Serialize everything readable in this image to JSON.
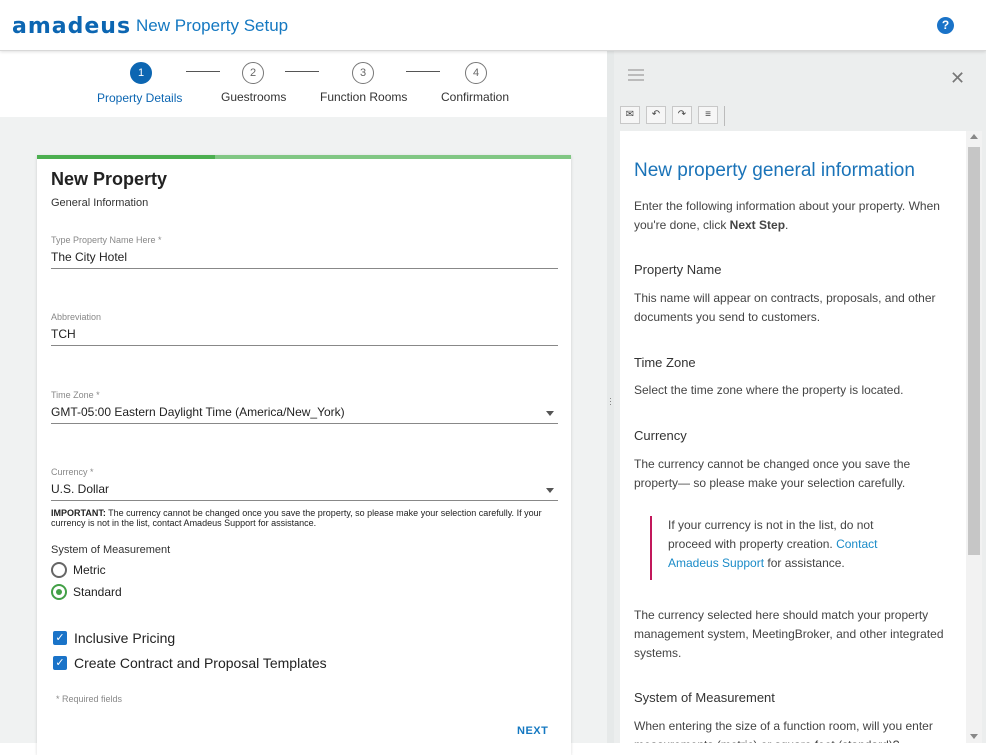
{
  "header": {
    "logo": "amadeus",
    "app_title": "New Property Setup",
    "help_icon": "?"
  },
  "stepper": {
    "steps": [
      {
        "number": "1",
        "label": "Property Details",
        "active": true
      },
      {
        "number": "2",
        "label": "Guestrooms",
        "active": false
      },
      {
        "number": "3",
        "label": "Function Rooms",
        "active": false
      },
      {
        "number": "4",
        "label": "Confirmation",
        "active": false
      }
    ],
    "progress_fraction": 0.333
  },
  "form": {
    "title": "New Property",
    "subtitle": "General Information",
    "property_name": {
      "label": "Type Property Name Here *",
      "value": "The City Hotel"
    },
    "abbreviation": {
      "label": "Abbreviation",
      "value": "TCH"
    },
    "time_zone": {
      "label": "Time Zone *",
      "value": "GMT-05:00 Eastern Daylight Time (America/New_York)"
    },
    "currency": {
      "label": "Currency *",
      "value": "U.S. Dollar"
    },
    "currency_note_bold": "IMPORTANT:",
    "currency_note": " The currency cannot be changed once you save the property, so please make your selection carefully. If your currency is not in the list, contact Amadeus Support for assistance.",
    "system_label": "System of Measurement",
    "system_options": [
      {
        "label": "Metric",
        "selected": false
      },
      {
        "label": "Standard",
        "selected": true
      }
    ],
    "checkboxes": [
      {
        "label": "Inclusive Pricing",
        "checked": true
      },
      {
        "label": "Create Contract and Proposal Templates",
        "checked": true
      }
    ],
    "required_note": "* Required fields",
    "next_label": "NEXT"
  },
  "help_panel": {
    "toolbar": [
      "mail-icon",
      "undo-icon",
      "redo-icon",
      "list-icon"
    ],
    "title": "New property general information",
    "intro_1": "Enter the following information about your property. When you're done, click ",
    "intro_bold": "Next Step",
    "intro_2": ".",
    "h_property_name": "Property Name",
    "p_property_name": "This name will appear on contracts, proposals, and other documents you send to customers.",
    "h_time_zone": "Time Zone",
    "p_time_zone": "Select the time zone where the property is located.",
    "h_currency": "Currency",
    "p_currency": "The currency cannot be changed once you save the property— so please make your selection carefully.",
    "callout_1": "If your currency is not in the list, do not proceed with property creation. ",
    "callout_link": "Contact Amadeus Support",
    "callout_2": " for assistance.",
    "p_currency_match": "The currency selected here should match your property management system, MeetingBroker, and other integrated systems.",
    "h_system": "System of Measurement",
    "p_system": "When entering the size of a function room, will you enter measurements (metric) or square feet (standard)?"
  }
}
